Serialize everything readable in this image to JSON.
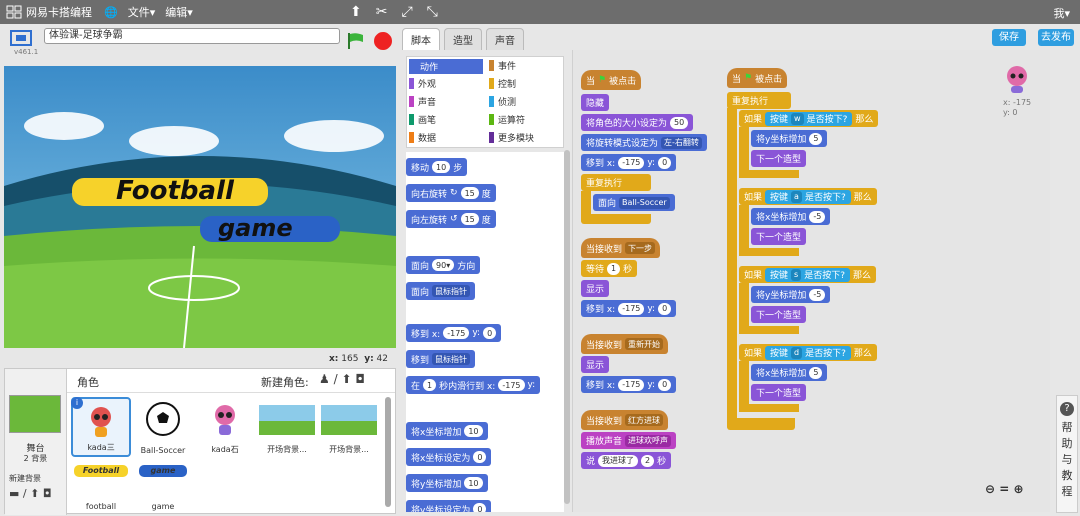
{
  "topbar": {
    "brand": "网易卡搭编程",
    "file": "文件▾",
    "edit": "编辑▾",
    "user": "我▾"
  },
  "project": {
    "title": "体验课-足球争霸",
    "version": "v461.1"
  },
  "stage": {
    "logo_line1": "Football",
    "logo_line2": "game",
    "coords_x_label": "x:",
    "coords_x": "165",
    "coords_y_label": "y:",
    "coords_y": "42"
  },
  "sprites": {
    "header": "角色",
    "new_sprite": "新建角色:",
    "stage_label": "舞台",
    "stage_sub": "2 背景",
    "new_backdrop": "新建背景",
    "items": [
      {
        "label": "kada三"
      },
      {
        "label": "Ball-Soccer"
      },
      {
        "label": "kada石"
      },
      {
        "label": "开场背景..."
      },
      {
        "label": "开场背景..."
      },
      {
        "label": "football"
      },
      {
        "label": "game"
      }
    ]
  },
  "tabs": {
    "scripts": "脚本",
    "costumes": "造型",
    "sounds": "声音"
  },
  "buttons": {
    "save": "保存",
    "share": "去发布"
  },
  "categories": [
    {
      "label": "动作",
      "color": "#4a6cd4"
    },
    {
      "label": "事件",
      "color": "#c88330"
    },
    {
      "label": "外观",
      "color": "#8a55d7"
    },
    {
      "label": "控制",
      "color": "#e1a91a"
    },
    {
      "label": "声音",
      "color": "#bb42c3"
    },
    {
      "label": "侦测",
      "color": "#2ca5e2"
    },
    {
      "label": "画笔",
      "color": "#0e9a6c"
    },
    {
      "label": "运算符",
      "color": "#5cb712"
    },
    {
      "label": "数据",
      "color": "#ee7d16"
    },
    {
      "label": "更多模块",
      "color": "#632d99"
    }
  ],
  "palette": {
    "move": "移动",
    "move_val": "10",
    "steps": "步",
    "turn_right": "向右旋转",
    "turn_val": "15",
    "deg": "度",
    "turn_left": "向左旋转",
    "point_dir": "面向",
    "dir_val": "90▾",
    "direction": "方向",
    "point_towards": "面向",
    "mouse": "鼠标指针",
    "goto_xy": "移到 x:",
    "x_val": "-175",
    "y_label": "y:",
    "y_val": "0",
    "goto": "移到",
    "glide": "在",
    "glide_secs": "1",
    "glide_mid": "秒内滑行到 x:",
    "change_x": "将x坐标增加",
    "set_x": "将x坐标设定为",
    "change_y": "将y坐标增加",
    "set_y": "将y坐标设定为",
    "ten": "10",
    "zero": "0"
  },
  "script": {
    "when_flag": "当",
    "clicked": "被点击",
    "hide": "隐藏",
    "set_size": "将角色的大小设定为",
    "size_val": "50",
    "set_rot": "将旋转模式设定为",
    "rot_val": "左-右翻转",
    "goto": "移到 x:",
    "x_val": "-175",
    "y": "y:",
    "y_val": "0",
    "forever": "重复执行",
    "point_towards": "面向",
    "ball": "Ball-Soccer",
    "when_recv": "当接收到",
    "msg1": "下一步",
    "wait": "等待",
    "wait_val": "1",
    "secs": "秒",
    "show": "显示",
    "msg2": "重新开始",
    "msg3": "红方进球",
    "play_sound": "播放声音",
    "sound_val": "进球欢呼声",
    "say": "说",
    "say_val": "我进球了",
    "say_secs": "2",
    "say_unit": "秒",
    "if": "如果",
    "key": "按键",
    "pressed": "是否按下?",
    "then": "那么",
    "keys": [
      "w",
      "a",
      "s",
      "d"
    ],
    "change_y": "将y坐标增加",
    "change_x": "将x坐标增加",
    "plus5": "5",
    "minus5": "-5",
    "next_costume": "下一个造型",
    "sprite_x": "x: -175",
    "sprite_y": "y: 0"
  },
  "help": "帮助与教程"
}
